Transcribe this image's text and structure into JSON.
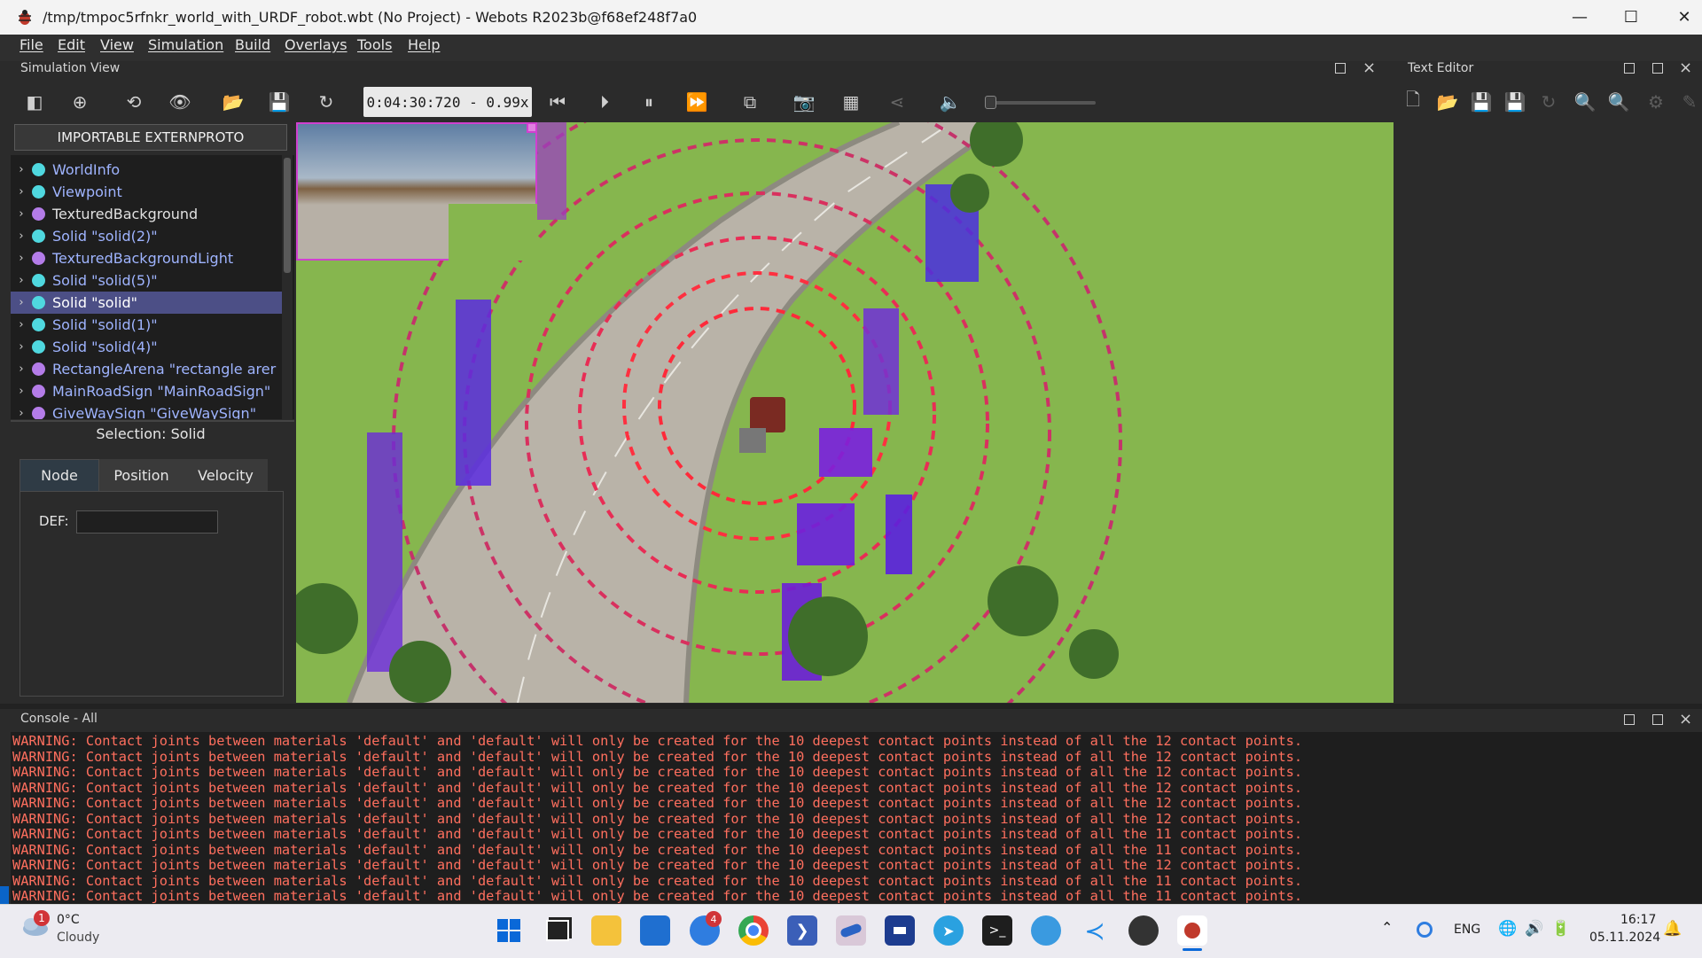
{
  "window": {
    "title": "/tmp/tmpoc5rfnkr_world_with_URDF_robot.wbt (No Project) - Webots R2023b@f68ef248f7a0",
    "controls": {
      "minimize": "—",
      "maximize": "☐",
      "close": "✕"
    }
  },
  "menu": [
    "File",
    "Edit",
    "View",
    "Simulation",
    "Build",
    "Overlays",
    "Tools",
    "Help"
  ],
  "simulation_view": {
    "title": "Simulation View",
    "clock": "0:04:30:720  -  0.99x"
  },
  "text_editor": {
    "title": "Text Editor"
  },
  "scene_tree": {
    "header": "IMPORTABLE EXTERNPROTO",
    "items": [
      {
        "label": "WorldInfo",
        "color": "#4fd8df",
        "text_color": "#9fb4ff"
      },
      {
        "label": "Viewpoint",
        "color": "#4fd8df",
        "text_color": "#9fb4ff"
      },
      {
        "label": "TexturedBackground",
        "color": "#b47ce8",
        "text_color": "#e0e0e0"
      },
      {
        "label": "Solid \"solid(2)\"",
        "color": "#4fd8df",
        "text_color": "#9fb4ff"
      },
      {
        "label": "TexturedBackgroundLight",
        "color": "#b47ce8",
        "text_color": "#9fb4ff"
      },
      {
        "label": "Solid \"solid(5)\"",
        "color": "#4fd8df",
        "text_color": "#9fb4ff"
      },
      {
        "label": "Solid \"solid\"",
        "color": "#4fd8df",
        "text_color": "#ffffff",
        "selected": true
      },
      {
        "label": "Solid \"solid(1)\"",
        "color": "#4fd8df",
        "text_color": "#9fb4ff"
      },
      {
        "label": "Solid \"solid(4)\"",
        "color": "#4fd8df",
        "text_color": "#9fb4ff"
      },
      {
        "label": "RectangleArena \"rectangle arer",
        "color": "#b47ce8",
        "text_color": "#9fb4ff"
      },
      {
        "label": "MainRoadSign \"MainRoadSign\"",
        "color": "#b47ce8",
        "text_color": "#9fb4ff"
      },
      {
        "label": "GiveWaySign \"GiveWaySign\"",
        "color": "#b47ce8",
        "text_color": "#9fb4ff"
      }
    ]
  },
  "properties": {
    "selection": "Selection: Solid",
    "tabs": [
      "Node",
      "Position",
      "Velocity"
    ],
    "def_label": "DEF:",
    "def_value": ""
  },
  "console": {
    "title": "Console - All",
    "lines": [
      "WARNING: Contact joints between materials 'default' and 'default' will only be created for the 10 deepest contact points instead of all the 12 contact points.",
      "WARNING: Contact joints between materials 'default' and 'default' will only be created for the 10 deepest contact points instead of all the 12 contact points.",
      "WARNING: Contact joints between materials 'default' and 'default' will only be created for the 10 deepest contact points instead of all the 12 contact points.",
      "WARNING: Contact joints between materials 'default' and 'default' will only be created for the 10 deepest contact points instead of all the 12 contact points.",
      "WARNING: Contact joints between materials 'default' and 'default' will only be created for the 10 deepest contact points instead of all the 12 contact points.",
      "WARNING: Contact joints between materials 'default' and 'default' will only be created for the 10 deepest contact points instead of all the 12 contact points.",
      "WARNING: Contact joints between materials 'default' and 'default' will only be created for the 10 deepest contact points instead of all the 11 contact points.",
      "WARNING: Contact joints between materials 'default' and 'default' will only be created for the 10 deepest contact points instead of all the 11 contact points.",
      "WARNING: Contact joints between materials 'default' and 'default' will only be created for the 10 deepest contact points instead of all the 12 contact points.",
      "WARNING: Contact joints between materials 'default' and 'default' will only be created for the 10 deepest contact points instead of all the 11 contact points.",
      "WARNING: Contact joints between materials 'default' and 'default' will only be created for the 10 deepest contact points instead of all the 11 contact points."
    ]
  },
  "taskbar": {
    "weather_temp": "0°C",
    "weather_desc": "Cloudy",
    "weather_badge": "1",
    "mail_badge": "4",
    "language": "ENG",
    "time": "16:17",
    "date": "05.11.2024"
  }
}
